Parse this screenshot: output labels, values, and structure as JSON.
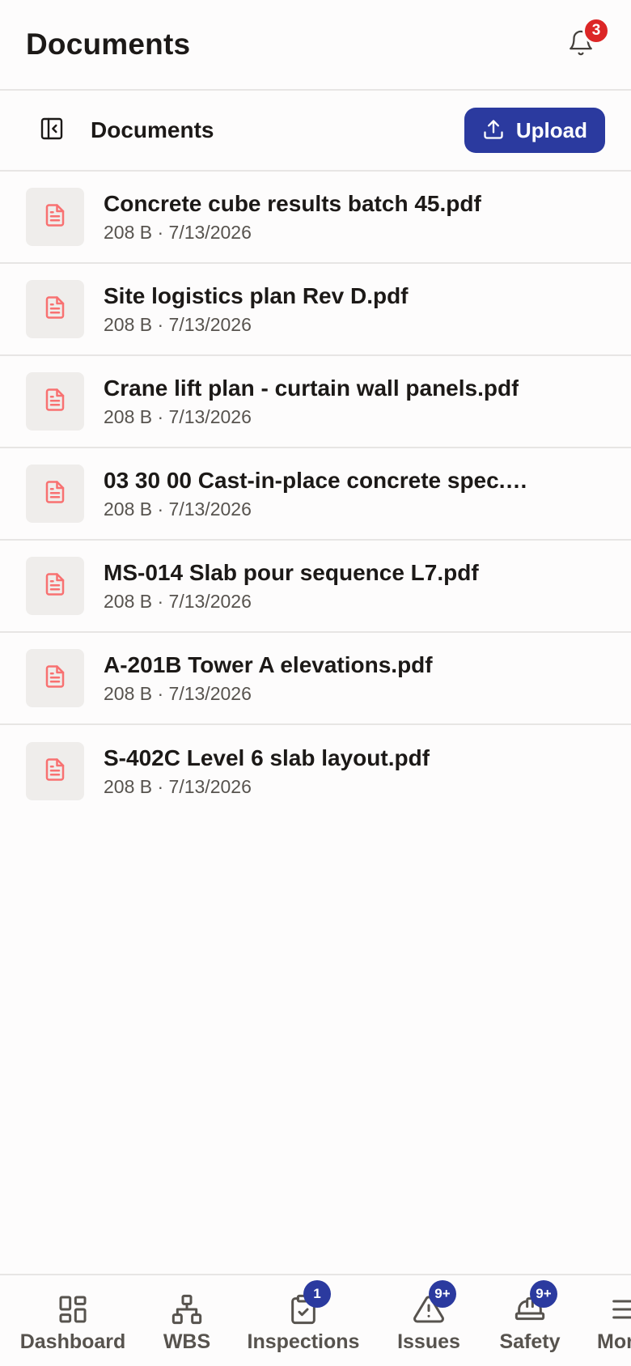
{
  "header": {
    "title": "Documents",
    "notification_count": "3"
  },
  "toolbar": {
    "title": "Documents",
    "upload_label": "Upload"
  },
  "documents": [
    {
      "name": "Concrete cube results batch 45.pdf",
      "meta": "208 B · 7/13/2026"
    },
    {
      "name": "Site logistics plan Rev D.pdf",
      "meta": "208 B · 7/13/2026"
    },
    {
      "name": "Crane lift plan - curtain wall panels.pdf",
      "meta": "208 B · 7/13/2026"
    },
    {
      "name": "03 30 00 Cast-in-place concrete spec.…",
      "meta": "208 B · 7/13/2026"
    },
    {
      "name": "MS-014 Slab pour sequence L7.pdf",
      "meta": "208 B · 7/13/2026"
    },
    {
      "name": "A-201B Tower A elevations.pdf",
      "meta": "208 B · 7/13/2026"
    },
    {
      "name": "S-402C Level 6 slab layout.pdf",
      "meta": "208 B · 7/13/2026"
    }
  ],
  "bottom_nav": [
    {
      "label": "Dashboard",
      "icon": "dashboard-icon",
      "badge": ""
    },
    {
      "label": "WBS",
      "icon": "hierarchy-icon",
      "badge": ""
    },
    {
      "label": "Inspections",
      "icon": "clipboard-check-icon",
      "badge": "1"
    },
    {
      "label": "Issues",
      "icon": "warning-icon",
      "badge": "9+"
    },
    {
      "label": "Safety",
      "icon": "hard-hat-icon",
      "badge": "9+"
    },
    {
      "label": "More",
      "icon": "menu-icon",
      "badge": ""
    }
  ],
  "colors": {
    "accent": "#2b3a9f",
    "notification_badge": "#dc2626",
    "file_icon": "#f87171",
    "file_tile": "#efedeb",
    "divider": "#e7e5e4"
  }
}
